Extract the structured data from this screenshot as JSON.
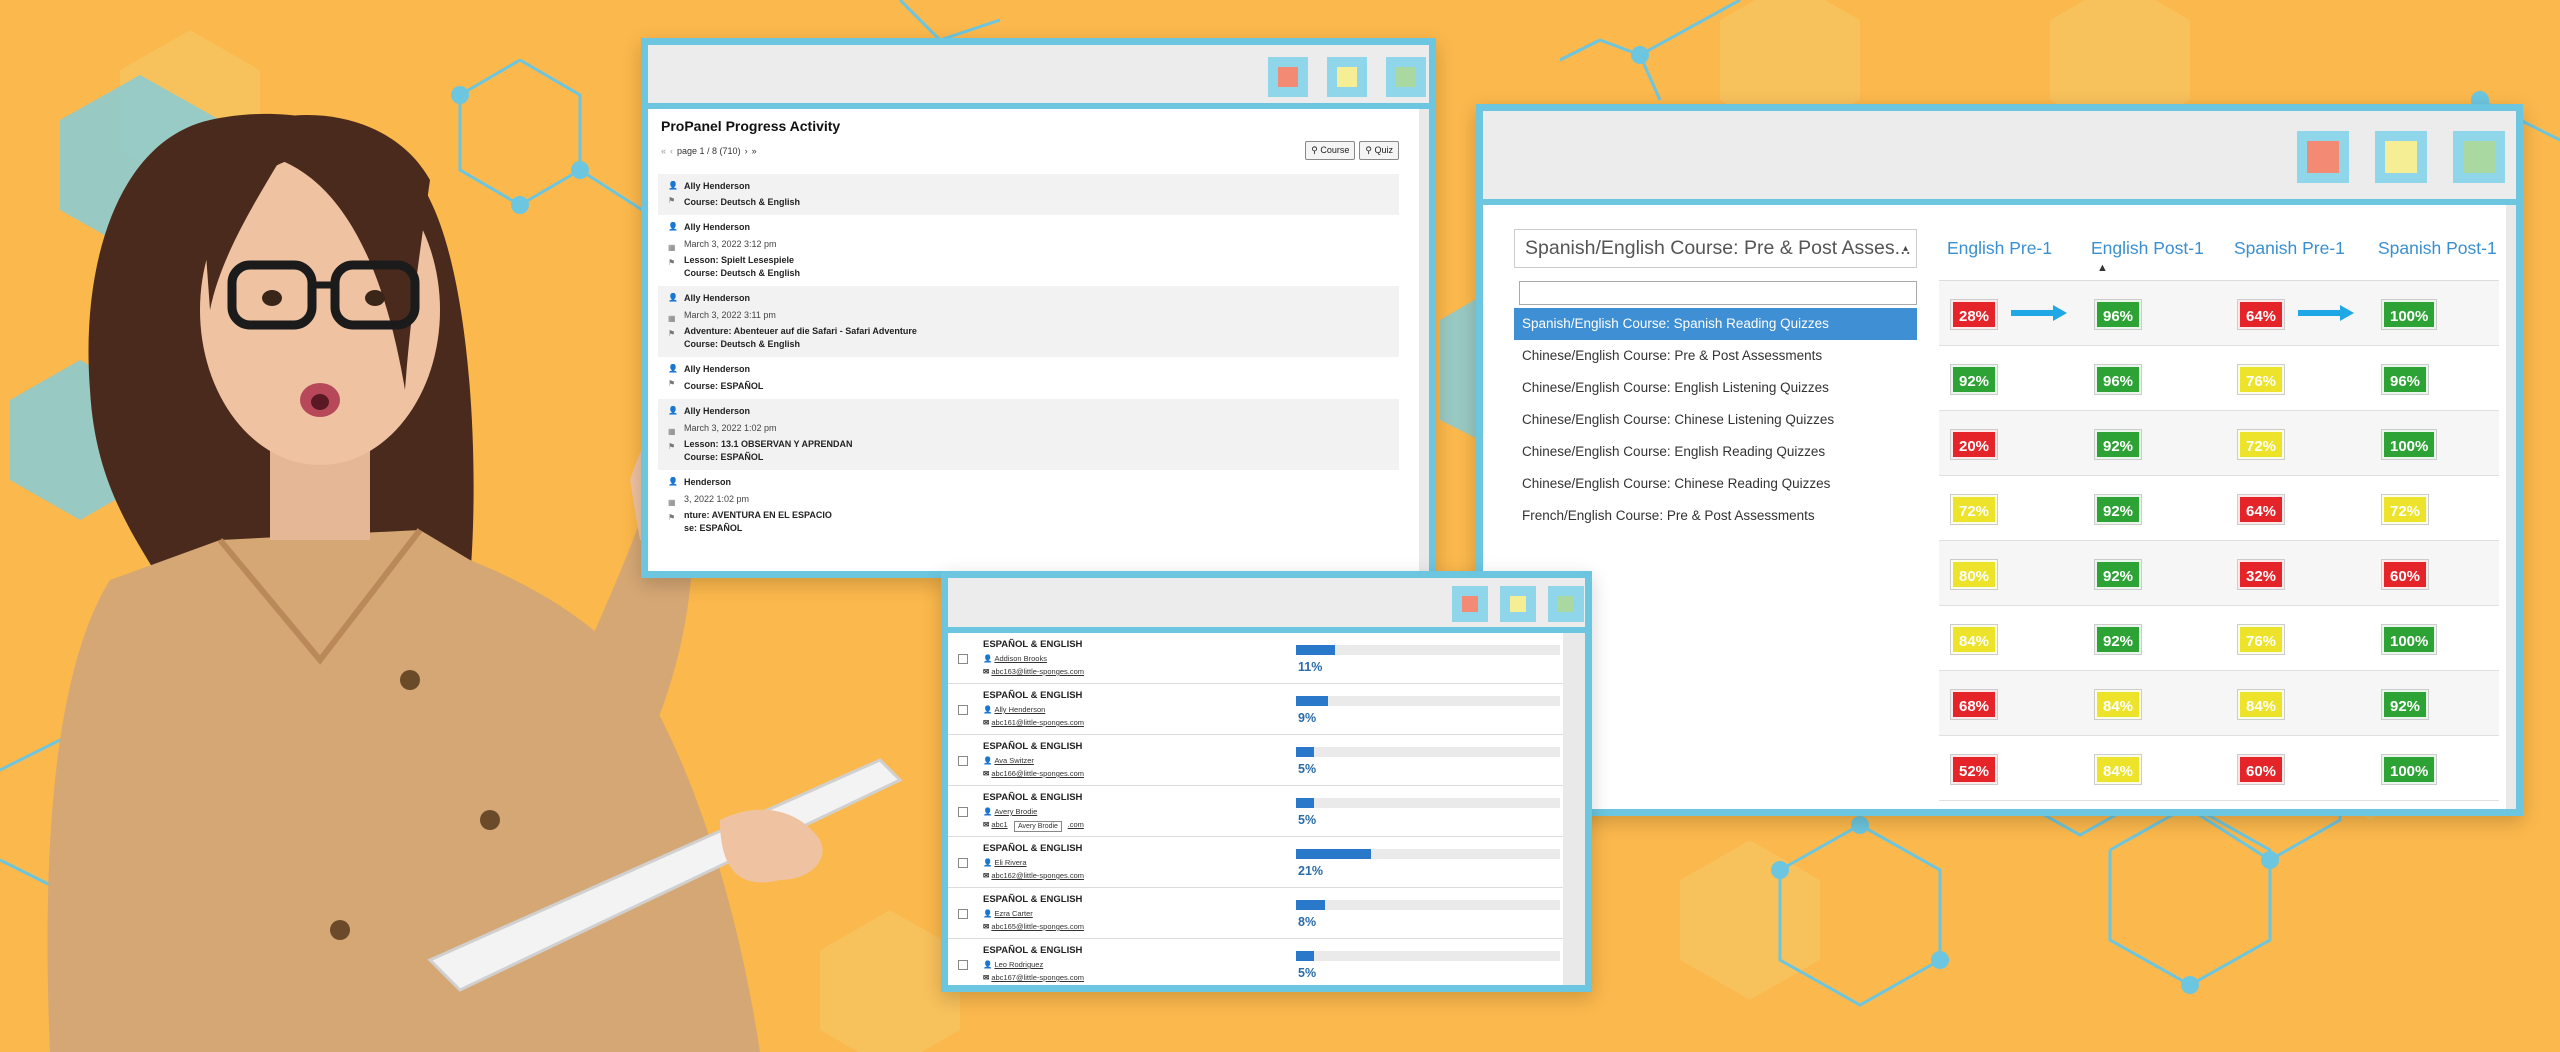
{
  "colors": {
    "background": "#fbb84c",
    "window_frame": "#6cc6df",
    "score_red": "#e5242a",
    "score_green": "#2ea335",
    "score_yellow": "#ece32a",
    "link_blue": "#3a8fd0",
    "arrow": "#1fa7e6"
  },
  "window_buttons": [
    "close",
    "minimize",
    "maximize"
  ],
  "activity": {
    "title": "ProPanel Progress Activity",
    "pager": "page 1 / 8 (710)",
    "filter_course": "Course",
    "filter_quiz": "Quiz",
    "items": [
      {
        "user": "Ally Henderson",
        "date": "",
        "lines": [
          "Course: Deutsch & English"
        ]
      },
      {
        "user": "Ally Henderson",
        "date": "March 3, 2022 3:12 pm",
        "lines": [
          "Lesson: Spielt Lesespiele",
          "Course: Deutsch & English"
        ]
      },
      {
        "user": "Ally Henderson",
        "date": "March 3, 2022 3:11 pm",
        "lines": [
          "Adventure: Abenteuer auf die Safari - Safari Adventure",
          "Course: Deutsch & English"
        ]
      },
      {
        "user": "Ally Henderson",
        "date": "",
        "lines": [
          "Course: ESPAÑOL"
        ]
      },
      {
        "user": "Ally Henderson",
        "date": "March 3, 2022 1:02 pm",
        "lines": [
          "Lesson: 13.1 OBSERVAN Y APRENDAN",
          "Course: ESPAÑOL"
        ]
      },
      {
        "user": "Henderson",
        "date": "3, 2022 1:02 pm",
        "lines": [
          "nture: AVENTURA EN EL ESPACIO",
          "se: ESPAÑOL"
        ]
      }
    ]
  },
  "assessment": {
    "select_value": "Spanish/English Course: Pre & Post Asses...",
    "courses": [
      "Spanish/English Course: Spanish Reading Quizzes",
      "Chinese/English Course: Pre & Post Assessments",
      "Chinese/English Course: English Listening Quizzes",
      "Chinese/English Course: Chinese Listening Quizzes",
      "Chinese/English Course: English Reading Quizzes",
      "Chinese/English Course: Chinese Reading Quizzes",
      "French/English Course: Pre & Post Assessments"
    ],
    "columns": [
      "English Pre-1",
      "English Post-1",
      "Spanish Pre-1",
      "Spanish Post-1"
    ],
    "rows": [
      [
        {
          "v": "28%",
          "c": "red"
        },
        {
          "v": "96%",
          "c": "green"
        },
        {
          "v": "64%",
          "c": "red"
        },
        {
          "v": "100%",
          "c": "green"
        }
      ],
      [
        {
          "v": "92%",
          "c": "green"
        },
        {
          "v": "96%",
          "c": "green"
        },
        {
          "v": "76%",
          "c": "yellow"
        },
        {
          "v": "96%",
          "c": "green"
        }
      ],
      [
        {
          "v": "20%",
          "c": "red"
        },
        {
          "v": "92%",
          "c": "green"
        },
        {
          "v": "72%",
          "c": "yellow"
        },
        {
          "v": "100%",
          "c": "green"
        }
      ],
      [
        {
          "v": "72%",
          "c": "yellow"
        },
        {
          "v": "92%",
          "c": "green"
        },
        {
          "v": "64%",
          "c": "red"
        },
        {
          "v": "72%",
          "c": "yellow"
        }
      ],
      [
        {
          "v": "80%",
          "c": "yellow"
        },
        {
          "v": "92%",
          "c": "green"
        },
        {
          "v": "32%",
          "c": "red"
        },
        {
          "v": "60%",
          "c": "red"
        }
      ],
      [
        {
          "v": "84%",
          "c": "yellow"
        },
        {
          "v": "92%",
          "c": "green"
        },
        {
          "v": "76%",
          "c": "yellow"
        },
        {
          "v": "100%",
          "c": "green"
        }
      ],
      [
        {
          "v": "68%",
          "c": "red"
        },
        {
          "v": "84%",
          "c": "yellow"
        },
        {
          "v": "84%",
          "c": "yellow"
        },
        {
          "v": "92%",
          "c": "green"
        }
      ],
      [
        {
          "v": "52%",
          "c": "red"
        },
        {
          "v": "84%",
          "c": "yellow"
        },
        {
          "v": "60%",
          "c": "red"
        },
        {
          "v": "100%",
          "c": "green"
        }
      ]
    ]
  },
  "progress": {
    "tooltip": "Avery Brodie",
    "rows": [
      {
        "course": "ESPAÑOL & ENGLISH",
        "user": "Addison Brooks",
        "email": "abc163@little-sponges.com",
        "percent": 11
      },
      {
        "course": "ESPAÑOL & ENGLISH",
        "user": "Ally Henderson",
        "email": "abc161@little-sponges.com",
        "percent": 9
      },
      {
        "course": "ESPAÑOL & ENGLISH",
        "user": "Ava Switzer",
        "email": "abc166@little-sponges.com",
        "percent": 5
      },
      {
        "course": "ESPAÑOL & ENGLISH",
        "user": "Avery Brodie",
        "email": "abc1",
        "email_tail": ".com",
        "percent": 5
      },
      {
        "course": "ESPAÑOL & ENGLISH",
        "user": "Eli Rivera",
        "email": "abc162@little-sponges.com",
        "percent": 21
      },
      {
        "course": "ESPAÑOL & ENGLISH",
        "user": "Ezra Carter",
        "email": "abc165@little-sponges.com",
        "percent": 8
      },
      {
        "course": "ESPAÑOL & ENGLISH",
        "user": "Leo Rodriguez",
        "email": "abc167@little-sponges.com",
        "percent": 5
      }
    ]
  }
}
